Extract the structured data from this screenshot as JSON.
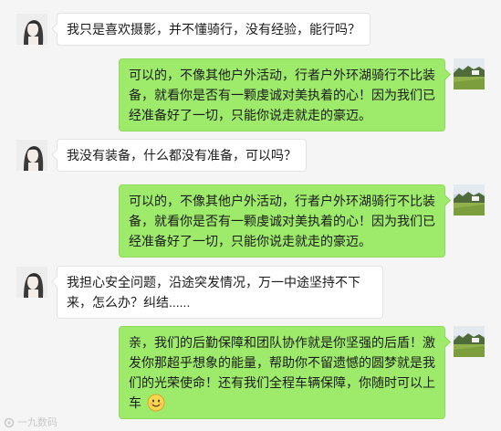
{
  "colors": {
    "background": "#f5f5f5",
    "incoming_bubble": "#ffffff",
    "outgoing_bubble": "#9eea6a"
  },
  "contacts": {
    "customer_avatar": "girl-portrait-avatar",
    "agent_avatar": "landscape-avatar"
  },
  "messages": [
    {
      "side": "left",
      "text": "我只是喜欢摄影，并不懂骑行，没有经验，能行吗？"
    },
    {
      "side": "right",
      "text": "可以的，不像其他户外活动，行者户外环湖骑行不比装备，就看你是否有一颗虔诚对美执着的心！因为我们已经准备好了一切，只能你说走就走的豪迈。"
    },
    {
      "side": "left",
      "text": "我没有装备，什么都没有准备，可以吗？"
    },
    {
      "side": "right",
      "text": "可以的，不像其他户外活动，行者户外环湖骑行不比装备，就看你是否有一颗虔诚对美执着的心！因为我们已经准备好了一切，只能你说走就走的豪迈。"
    },
    {
      "side": "left",
      "text": "我担心安全问题，沿途突发情况，万一中途坚持不下来，怎么办？纠结......"
    },
    {
      "side": "right",
      "text": "亲，我们的后勤保障和团队协作就是你坚强的后盾！激发你那超乎想象的能量，帮助你不留遗憾的圆梦就是我们的光荣使命！还有我们全程车辆保障，你随时可以上车",
      "emoji": "smile-emoji"
    }
  ],
  "watermark": "一九数码"
}
